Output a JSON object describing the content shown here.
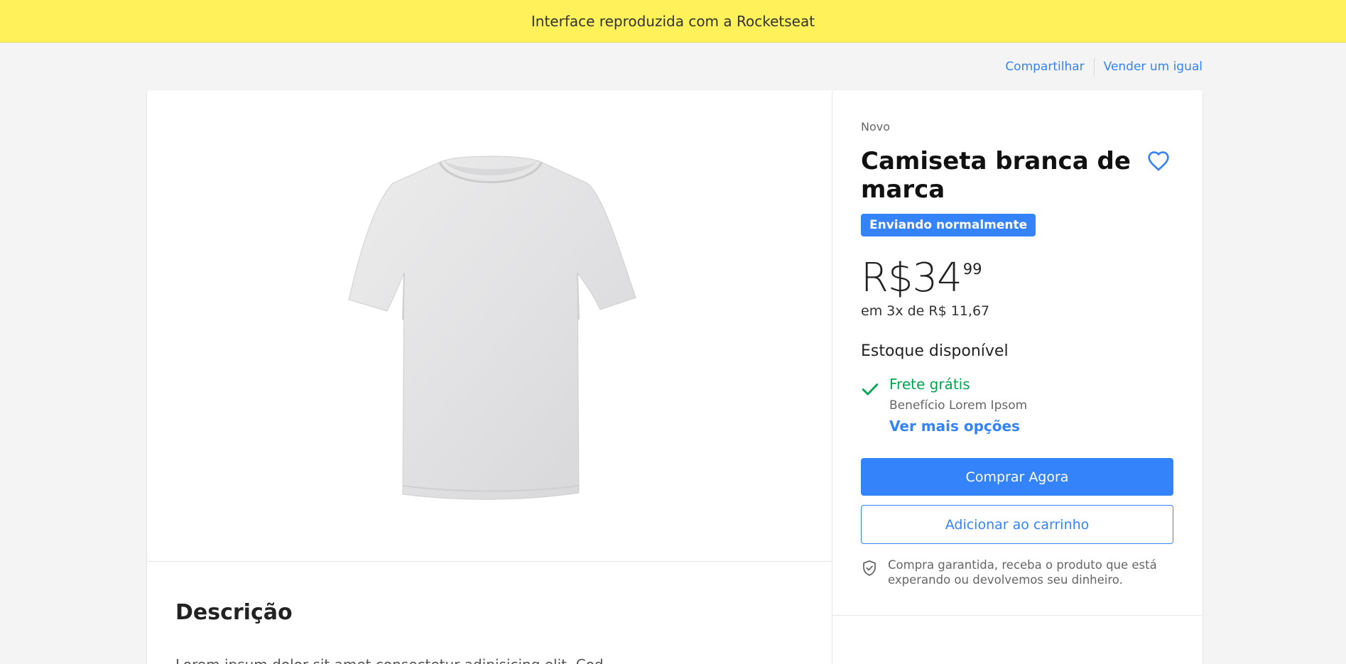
{
  "banner": {
    "text": "Interface reproduzida com a Rocketseat",
    "color": "#fff159"
  },
  "top_links": {
    "share": "Compartilhar",
    "sell": "Vender um igual"
  },
  "product": {
    "condition": "Novo",
    "title": "Camiseta branca de marca",
    "badge": "Enviando normalmente",
    "price": {
      "currency_amount": "R$34",
      "cents": "99"
    },
    "installments": "em 3x de R$ 11,67",
    "stock": "Estoque disponível",
    "shipping": {
      "title": "Frete grátis",
      "benefit": "Benefício Lorem Ipsom",
      "more_options": "Ver mais opções"
    },
    "buy_button": "Comprar Agora",
    "cart_button": "Adicionar ao carrinho",
    "guarantee": "Compra garantida, receba o produto que está experando ou devolvemos seu dinheiro."
  },
  "description": {
    "title": "Descrição",
    "text": "Lorem ipsum dolor sit amet consectetur adipisicing elit. Cod"
  },
  "icons": {
    "favorite": "heart-icon",
    "check": "check-icon",
    "guarantee": "shield-check-icon"
  },
  "colors": {
    "accent": "#3483fa",
    "success": "#00a650",
    "banner": "#fff159"
  }
}
